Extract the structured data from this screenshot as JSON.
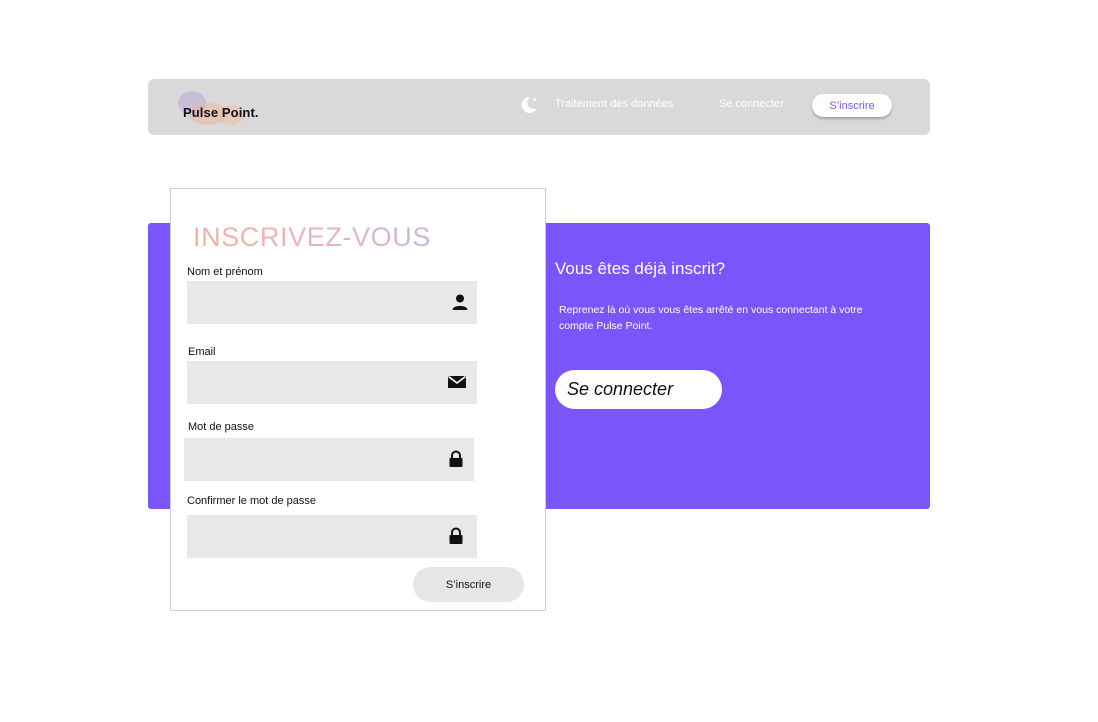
{
  "header": {
    "logo_text": "Pulse Point.",
    "nav": {
      "data_processing": "Traitement des données",
      "login": "Se connecter",
      "signup": "S’inscrire"
    }
  },
  "banner": {
    "title": "Vous êtes déjà inscrit?",
    "text": "Reprenez là où vous vous êtes arrêté en vous connectant à votre compte Pulse Point.",
    "button": "Se connecter"
  },
  "form": {
    "title": "INSCRIVEZ-VOUS",
    "fields": [
      {
        "label": "Nom et prénom",
        "value": "",
        "icon": "user-icon"
      },
      {
        "label": "Email",
        "value": "",
        "icon": "envelope-icon"
      },
      {
        "label": "Mot de passe",
        "value": "",
        "icon": "lock-icon"
      },
      {
        "label": "Confirmer le mot de passe",
        "value": "",
        "icon": "lock-icon"
      }
    ],
    "submit": "S’inscrire"
  },
  "colors": {
    "accent": "#7b55fc",
    "nav_bg": "#d9d9d9",
    "field_bg": "#e8e8e8"
  }
}
